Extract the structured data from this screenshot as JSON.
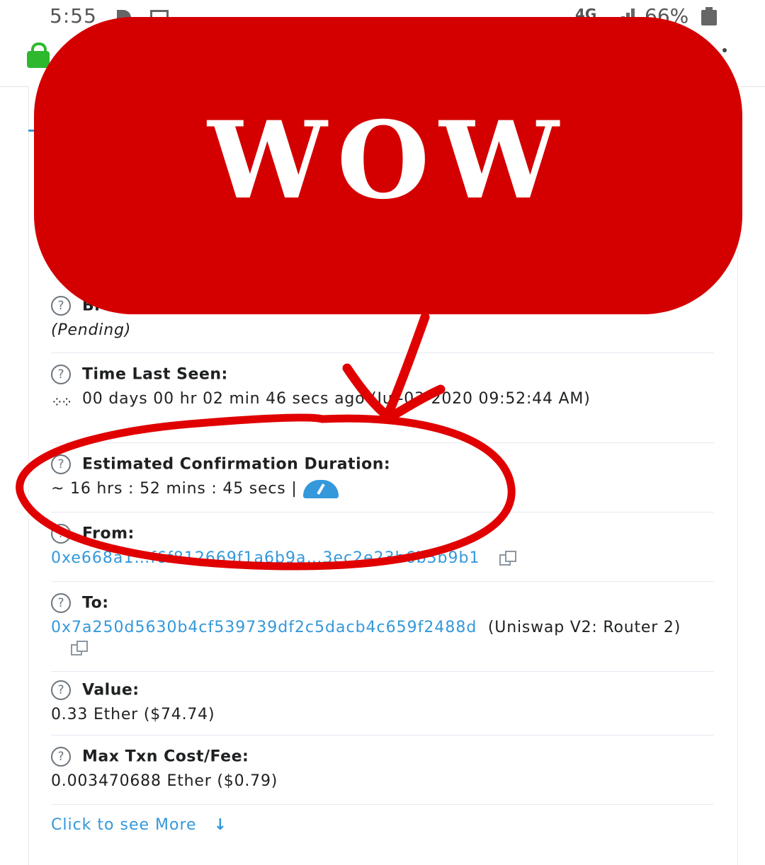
{
  "status_bar": {
    "time": "5:55",
    "network": "4G",
    "battery": "66%"
  },
  "overlay": {
    "banner_text": "WOW",
    "banner_color": "#d40000"
  },
  "details": {
    "block_label": "Bl",
    "block_value": "(Pending)",
    "time_last_seen_label": "Time Last Seen:",
    "time_last_seen_value": "00 days 00 hr 02 min 46 secs ago (Jul-03-2020 09:52:44 AM)",
    "est_confirmation_label": "Estimated Confirmation Duration:",
    "est_confirmation_value": "~ 16 hrs : 52 mins : 45 secs |",
    "from_label": "From:",
    "from_address": "0xe668a1…f6f812669f1a6b9a…3ec2e23b6b3b9b1",
    "to_label": "To:",
    "to_address": "0x7a250d5630b4cf539739df2c5dacb4c659f2488d",
    "to_name": "(Uniswap V2: Router 2)",
    "value_label": "Value:",
    "value_value": "0.33 Ether ($74.74)",
    "max_fee_label": "Max Txn Cost/Fee:",
    "max_fee_value": "0.003470688 Ether ($0.79)",
    "more_link": "Click to see More"
  },
  "colors": {
    "link": "#3498db",
    "annotation_red": "#e00000"
  }
}
